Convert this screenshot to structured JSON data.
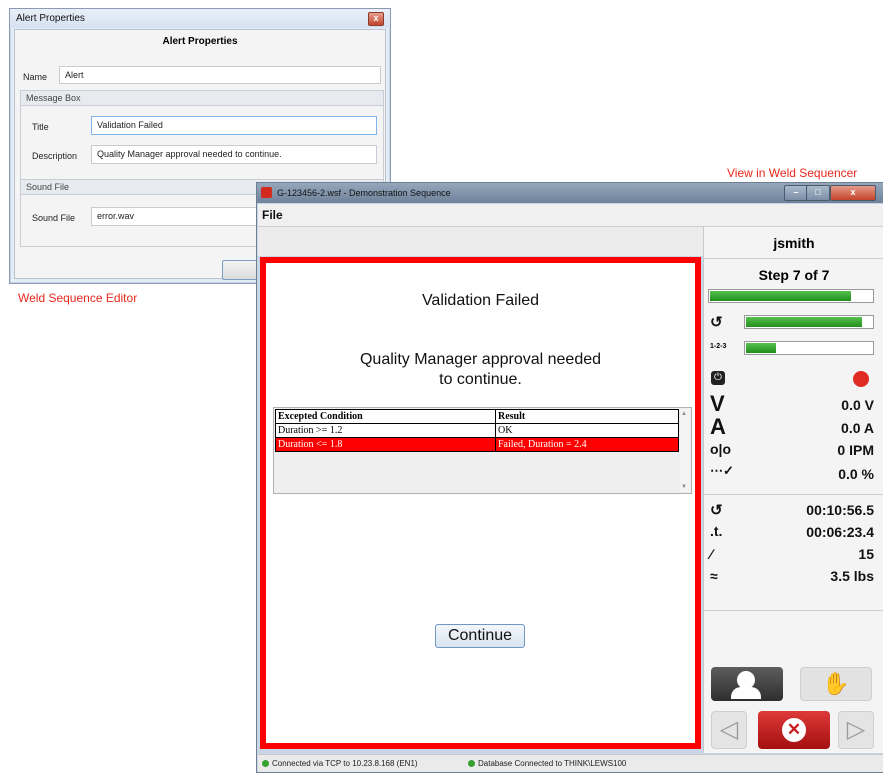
{
  "editor": {
    "window_title": "Alert Properties",
    "close_glyph": "x",
    "header": "Alert Properties",
    "name_label": "Name",
    "name_value": "Alert",
    "message_box": {
      "group_label": "Message Box",
      "title_label": "Title",
      "title_value": "Validation Failed",
      "description_label": "Description",
      "description_value": "Quality Manager approval needed to continue."
    },
    "sound_file": {
      "group_label": "Sound File",
      "label": "Sound File",
      "value": "error.wav"
    }
  },
  "caption_editor": "Weld Sequence Editor",
  "caption_sequencer": "View in Weld Sequencer",
  "sequencer": {
    "window_title": "G-123456-2.wsf - Demonstration Sequence",
    "menu_file": "File",
    "alert_title": "Validation Failed",
    "alert_message_line1": "Quality Manager approval needed",
    "alert_message_line2": "to continue.",
    "table": {
      "headers": [
        "Excepted Condition",
        "Result"
      ],
      "rows": [
        {
          "condition": "Duration >= 1.2",
          "result": "OK",
          "failed": false
        },
        {
          "condition": "Duration <= 1.8",
          "result": "Failed, Duration = 2.4",
          "failed": true
        }
      ]
    },
    "continue_button": "Continue",
    "status": {
      "tcp": "Connected via TCP to 10.23.8.168 (EN1)",
      "db": "Database Connected to THINK\\LEWS100"
    },
    "sidebar": {
      "user": "jsmith",
      "step": "Step 7 of 7",
      "progress": {
        "step_fraction": 0.87,
        "timer_fraction": 0.92,
        "count_fraction": 0.25
      },
      "counter_icon_text": "1-2-3",
      "readings": {
        "voltage": "0.0 V",
        "current": "0.0 A",
        "wire_feed": "0 IPM",
        "percent": "0.0 %"
      },
      "totals": {
        "arc_time": "00:10:56.5",
        "elapsed": "00:06:23.4",
        "count": "15",
        "weight": "3.5 lbs"
      },
      "icons": {
        "volt": "V",
        "amp": "A"
      }
    }
  },
  "colors": {
    "alert_red": "#ff0000",
    "progress_green": "#2aa025",
    "status_ok": "#37a02e",
    "caption_red": "#e8281c"
  }
}
